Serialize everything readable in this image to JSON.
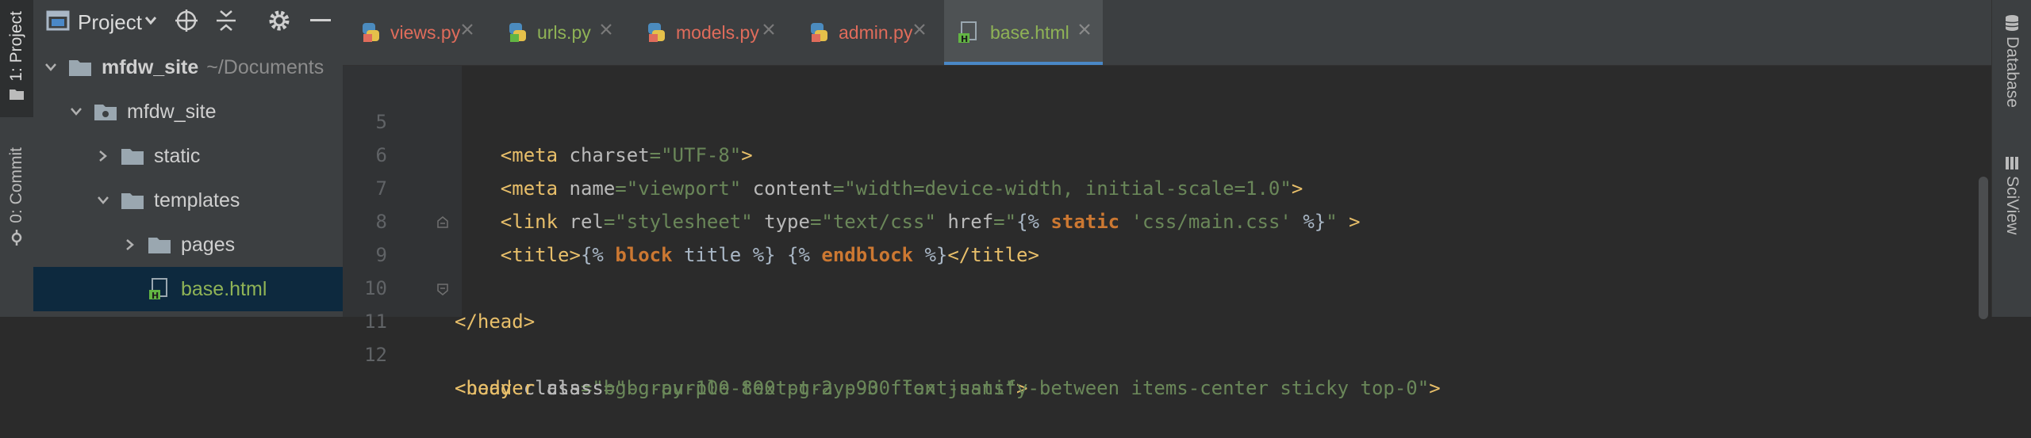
{
  "left_strip": {
    "project_tab": "1: Project",
    "commit_tab": "0: Commit"
  },
  "project_panel": {
    "title": "Project",
    "icons": [
      "project-icon",
      "dropdown-icon",
      "locate-icon",
      "collapse-icon",
      "gear-icon",
      "minimize-icon"
    ],
    "tree": [
      {
        "label": "mfdw_site",
        "suffix": "~/Documents",
        "type": "project-root",
        "expanded": true
      },
      {
        "label": "mfdw_site",
        "type": "package-folder",
        "expanded": true
      },
      {
        "label": "static",
        "type": "folder",
        "expanded": false
      },
      {
        "label": "templates",
        "type": "folder",
        "expanded": true
      },
      {
        "label": "pages",
        "type": "folder",
        "expanded": false
      },
      {
        "label": "base.html",
        "type": "html-file",
        "selected": true
      }
    ]
  },
  "tabs": [
    {
      "label": "views.py",
      "icon": "python-icon",
      "color": "#e06c5b"
    },
    {
      "label": "urls.py",
      "icon": "python-icon",
      "color": "#8fb356"
    },
    {
      "label": "models.py",
      "icon": "python-icon",
      "color": "#e06c5b"
    },
    {
      "label": "admin.py",
      "icon": "python-icon",
      "color": "#e06c5b"
    },
    {
      "label": "base.html",
      "icon": "html-icon",
      "color": "#8fb356",
      "active": true
    }
  ],
  "editor": {
    "lines": [
      {
        "n": "5",
        "text": "    <meta charset=\"UTF-8\">"
      },
      {
        "n": "6",
        "text": "    <meta name=\"viewport\" content=\"width=device-width, initial-scale=1.0\">"
      },
      {
        "n": "7",
        "text": "    <link rel=\"stylesheet\" type=\"text/css\" href=\"{% static 'css/main.css' %}\" >"
      },
      {
        "n": "8",
        "text": "    <title>{% block title %} {% endblock %}</title>"
      },
      {
        "n": "9",
        "text": "</head>"
      },
      {
        "n": "10",
        "text": ""
      },
      {
        "n": "11",
        "text": "<body class=\"bg-gray-100 text-gray-900 font-sans\">"
      },
      {
        "n": "12",
        "text": "<header class=\"bg-purple-800 pt-2 p-3 flex justify-between items-center sticky top-0\">"
      }
    ],
    "error_marker": "error-icon"
  },
  "right_strip": {
    "database_tab": "Database",
    "sciview_tab": "SciView"
  }
}
